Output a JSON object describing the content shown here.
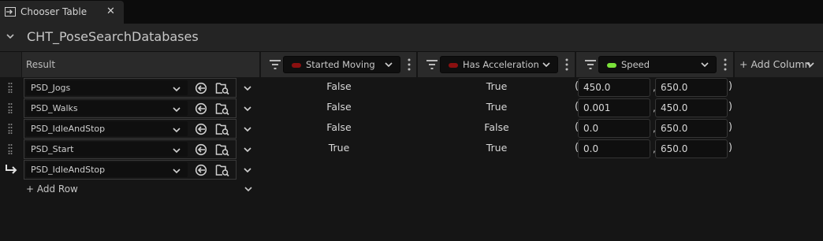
{
  "tab": {
    "title": "Chooser Table",
    "close": "✕",
    "icon": "chooser-table-icon"
  },
  "asset": {
    "name": "CHT_PoseSearchDatabases"
  },
  "header": {
    "result_label": "Result",
    "columns": [
      {
        "label": "Started Moving",
        "swatch_color": "#8b1010"
      },
      {
        "label": "Has Acceleration",
        "swatch_color": "#8b1010"
      },
      {
        "label": "Speed",
        "swatch_color": "#7be23a"
      }
    ],
    "add_column": "+ Add Column"
  },
  "rows": [
    {
      "result": "PSD_Jogs",
      "started_moving": "False",
      "has_acceleration": "True",
      "speed_min": "450.0",
      "speed_max": "650.0"
    },
    {
      "result": "PSD_Walks",
      "started_moving": "False",
      "has_acceleration": "True",
      "speed_min": "0.001",
      "speed_max": "450.0"
    },
    {
      "result": "PSD_IdleAndStop",
      "started_moving": "False",
      "has_acceleration": "False",
      "speed_min": "0.0",
      "speed_max": "650.0"
    },
    {
      "result": "PSD_Start",
      "started_moving": "True",
      "has_acceleration": "True",
      "speed_min": "0.0",
      "speed_max": "650.0"
    },
    {
      "result": "PSD_IdleAndStop",
      "fallback": true
    }
  ],
  "range": {
    "open": "(",
    "sep": ",",
    "close": ")"
  },
  "add_row": "+ Add Row"
}
